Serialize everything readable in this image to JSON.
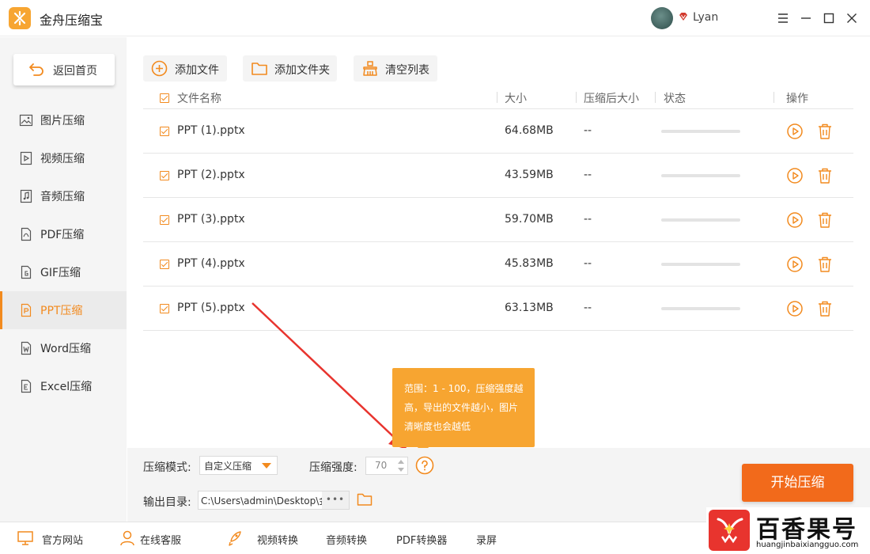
{
  "app": {
    "title": "金舟压缩宝",
    "username": "Lyan"
  },
  "sidebar": {
    "back_label": "返回首页",
    "items": [
      {
        "label": "图片压缩",
        "icon": "image-icon"
      },
      {
        "label": "视频压缩",
        "icon": "video-icon"
      },
      {
        "label": "音频压缩",
        "icon": "audio-icon"
      },
      {
        "label": "PDF压缩",
        "icon": "pdf-icon"
      },
      {
        "label": "GIF压缩",
        "icon": "gif-icon"
      },
      {
        "label": "PPT压缩",
        "icon": "ppt-icon",
        "active": true
      },
      {
        "label": "Word压缩",
        "icon": "word-icon"
      },
      {
        "label": "Excel压缩",
        "icon": "excel-icon"
      }
    ]
  },
  "toolbar": {
    "add_file": "添加文件",
    "add_folder": "添加文件夹",
    "clear_list": "清空列表"
  },
  "table": {
    "headers": {
      "name": "文件名称",
      "size": "大小",
      "after": "压缩后大小",
      "status": "状态",
      "actions": "操作"
    },
    "rows": [
      {
        "name": "PPT (1).pptx",
        "size": "64.68MB",
        "after": "--",
        "progress": 0
      },
      {
        "name": "PPT (2).pptx",
        "size": "43.59MB",
        "after": "--",
        "progress": 0
      },
      {
        "name": "PPT (3).pptx",
        "size": "59.70MB",
        "after": "--",
        "progress": 0
      },
      {
        "name": "PPT (4).pptx",
        "size": "45.83MB",
        "after": "--",
        "progress": 0
      },
      {
        "name": "PPT (5).pptx",
        "size": "63.13MB",
        "after": "--",
        "progress": 0
      }
    ]
  },
  "tooltip": {
    "lines": [
      "范围：1 - 100，压缩强度越",
      "高，导出的文件越小，图片",
      "清晰度也会越低"
    ]
  },
  "settings": {
    "mode_label": "压缩模式:",
    "mode_value": "自定义压缩",
    "strength_label": "压缩强度:",
    "strength_value": "70",
    "output_label": "输出目录:",
    "output_path": "C:\\Users\\admin\\Desktop\\金舟",
    "browse_label": "•••"
  },
  "start_button": "开始压缩",
  "footer": {
    "website": "官方网站",
    "support": "在线客服",
    "video": "视频转换",
    "audio": "音频转换",
    "pdf": "PDF转换器",
    "record": "录屏"
  },
  "watermark": {
    "title": "百香果号",
    "url": "huangjinbaixiangguo.com"
  },
  "colors": {
    "accent": "#f28a1e",
    "start_button": "#f26a1b",
    "tooltip": "#f7a531",
    "arrow": "#e8342e"
  }
}
